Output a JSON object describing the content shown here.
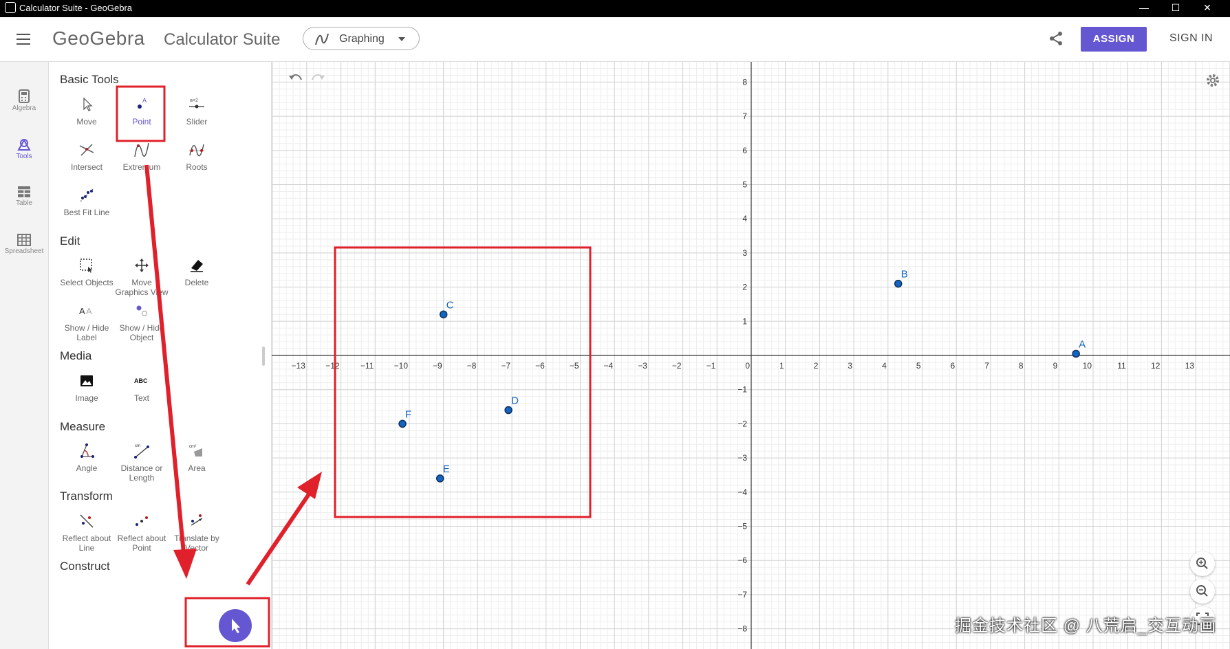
{
  "window": {
    "title": "Calculator Suite - GeoGebra",
    "minimize": "—",
    "maximize": "☐",
    "close": "✕"
  },
  "header": {
    "logo": "GeoGebra",
    "app_name": "Calculator Suite",
    "mode_selector": "Graphing",
    "assign_label": "ASSIGN",
    "signin_label": "SIGN IN",
    "accent": "#6557d2"
  },
  "rail": [
    {
      "label": "Algebra",
      "icon": "calculator-icon"
    },
    {
      "label": "Tools",
      "icon": "tools-icon",
      "active": true
    },
    {
      "label": "Table",
      "icon": "table-icon"
    },
    {
      "label": "Spreadsheet",
      "icon": "spreadsheet-icon"
    }
  ],
  "tools": {
    "basic": {
      "title": "Basic Tools",
      "items": [
        "Move",
        "Point",
        "Slider",
        "Intersect",
        "Extremum",
        "Roots",
        "Best Fit Line"
      ]
    },
    "edit": {
      "title": "Edit",
      "items": [
        "Select Objects",
        "Move Graphics View",
        "Delete",
        "Show / Hide Label",
        "Show / Hide Object"
      ]
    },
    "media": {
      "title": "Media",
      "items": [
        "Image",
        "Text"
      ]
    },
    "measure": {
      "title": "Measure",
      "items": [
        "Angle",
        "Distance or Length",
        "Area"
      ]
    },
    "transform": {
      "title": "Transform",
      "items": [
        "Reflect about Line",
        "Reflect about Point",
        "Translate by Vector"
      ]
    },
    "construct": {
      "title": "Construct"
    },
    "selected": "Point"
  },
  "graph": {
    "x_ticks": [
      -13,
      -12,
      -11,
      -10,
      -9,
      -8,
      -7,
      -6,
      -5,
      -4,
      -3,
      -2,
      -1,
      0,
      1,
      2,
      3,
      4,
      5,
      6,
      7,
      8,
      9,
      10,
      11,
      12,
      13
    ],
    "y_ticks": [
      8,
      7,
      6,
      5,
      4,
      3,
      2,
      1,
      -1,
      -2,
      -3,
      -4,
      -5,
      -6,
      -7,
      -8
    ],
    "grid": true,
    "points": [
      {
        "name": "A",
        "x": 9.5,
        "y": 0.05
      },
      {
        "name": "B",
        "x": 4.3,
        "y": 2.1
      },
      {
        "name": "C",
        "x": -9.0,
        "y": 1.2
      },
      {
        "name": "D",
        "x": -7.1,
        "y": -1.6
      },
      {
        "name": "E",
        "x": -9.1,
        "y": -3.6
      },
      {
        "name": "F",
        "x": -10.2,
        "y": -2.0
      }
    ],
    "point_color": "#1565c0"
  },
  "annotation_color": "#e0202a",
  "watermark": "掘金技术社区 @ 八荒启_交互动画"
}
